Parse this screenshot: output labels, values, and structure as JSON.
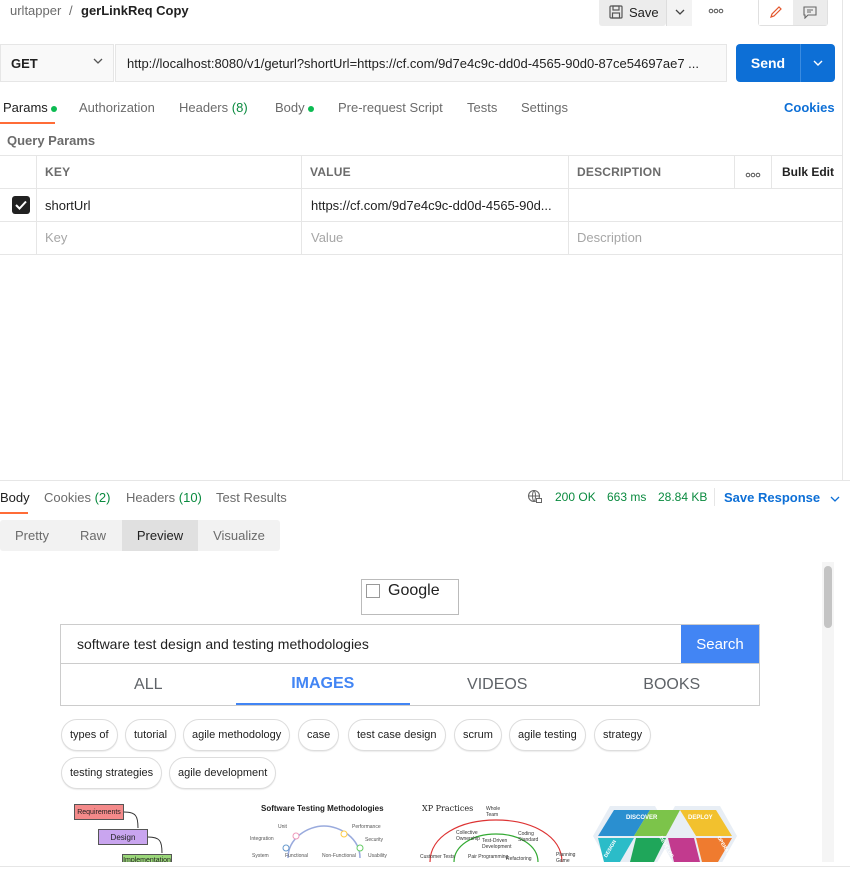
{
  "breadcrumb": {
    "parent": "urltapper",
    "separator": "/",
    "title": "gerLinkReq Copy"
  },
  "toolbar": {
    "save_label": "Save"
  },
  "request": {
    "method": "GET",
    "url": "http://localhost:8080/v1/geturl?shortUrl=https://cf.com/9d7e4c9c-dd0d-4565-90d0-87ce54697ae7 ...",
    "send_label": "Send"
  },
  "request_tabs": {
    "params": "Params",
    "authorization": "Authorization",
    "headers": "Headers",
    "headers_count": "(8)",
    "body": "Body",
    "pre_request": "Pre-request Script",
    "tests": "Tests",
    "settings": "Settings",
    "cookies": "Cookies"
  },
  "query_params": {
    "title": "Query Params",
    "columns": {
      "key": "KEY",
      "value": "VALUE",
      "description": "DESCRIPTION",
      "bulk_edit": "Bulk Edit"
    },
    "row": {
      "key": "shortUrl",
      "value": "https://cf.com/9d7e4c9c-dd0d-4565-90d...",
      "description": "",
      "checked": true
    },
    "placeholder": {
      "key": "Key",
      "value": "Value",
      "description": "Description"
    }
  },
  "response_tabs": {
    "body": "Body",
    "cookies": "Cookies",
    "cookies_count": "(2)",
    "headers": "Headers",
    "headers_count": "(10)",
    "test_results": "Test Results"
  },
  "response_status": {
    "status": "200 OK",
    "time": "663 ms",
    "size": "28.84 KB",
    "save": "Save Response"
  },
  "view_tabs": {
    "pretty": "Pretty",
    "raw": "Raw",
    "preview": "Preview",
    "visualize": "Visualize"
  },
  "preview": {
    "logo_alt": "Google",
    "query": "software test design and testing methodologies",
    "search_button": "Search",
    "tabs": [
      "ALL",
      "IMAGES",
      "VIDEOS",
      "BOOKS"
    ],
    "active_tab": "IMAGES",
    "chips_row1": [
      "types of",
      "tutorial",
      "agile methodology",
      "case",
      "test case design",
      "scrum",
      "agile testing",
      "strategy"
    ],
    "chips_row2": [
      "testing strategies",
      "agile development"
    ],
    "thumb1": {
      "box1": "Requirements",
      "box2": "Design",
      "box3": "Implementation"
    },
    "thumb2": {
      "title": "Software Testing Methodologies",
      "labels": [
        "Unit",
        "Performance",
        "Integration",
        "Security",
        "System",
        "Functional",
        "Non-Functional",
        "Usability"
      ]
    },
    "thumb3": {
      "title": "XP Practices",
      "labels": [
        "Whole Team",
        "Collective Ownership",
        "Coding Standard",
        "Test-Driven Development",
        "Customer Tests",
        "Pair Programming",
        "Refactoring",
        "Planning Game"
      ]
    },
    "thumb4": {
      "labels": [
        "DISCOVER",
        "DEPLOY",
        "DESIGN",
        "DEVELOP",
        "OPERATE"
      ]
    }
  },
  "colors": {
    "accent": "#ff6c37",
    "send": "#0d6fd6",
    "ok": "#0a8a3f",
    "google_blue": "#4285f4"
  }
}
